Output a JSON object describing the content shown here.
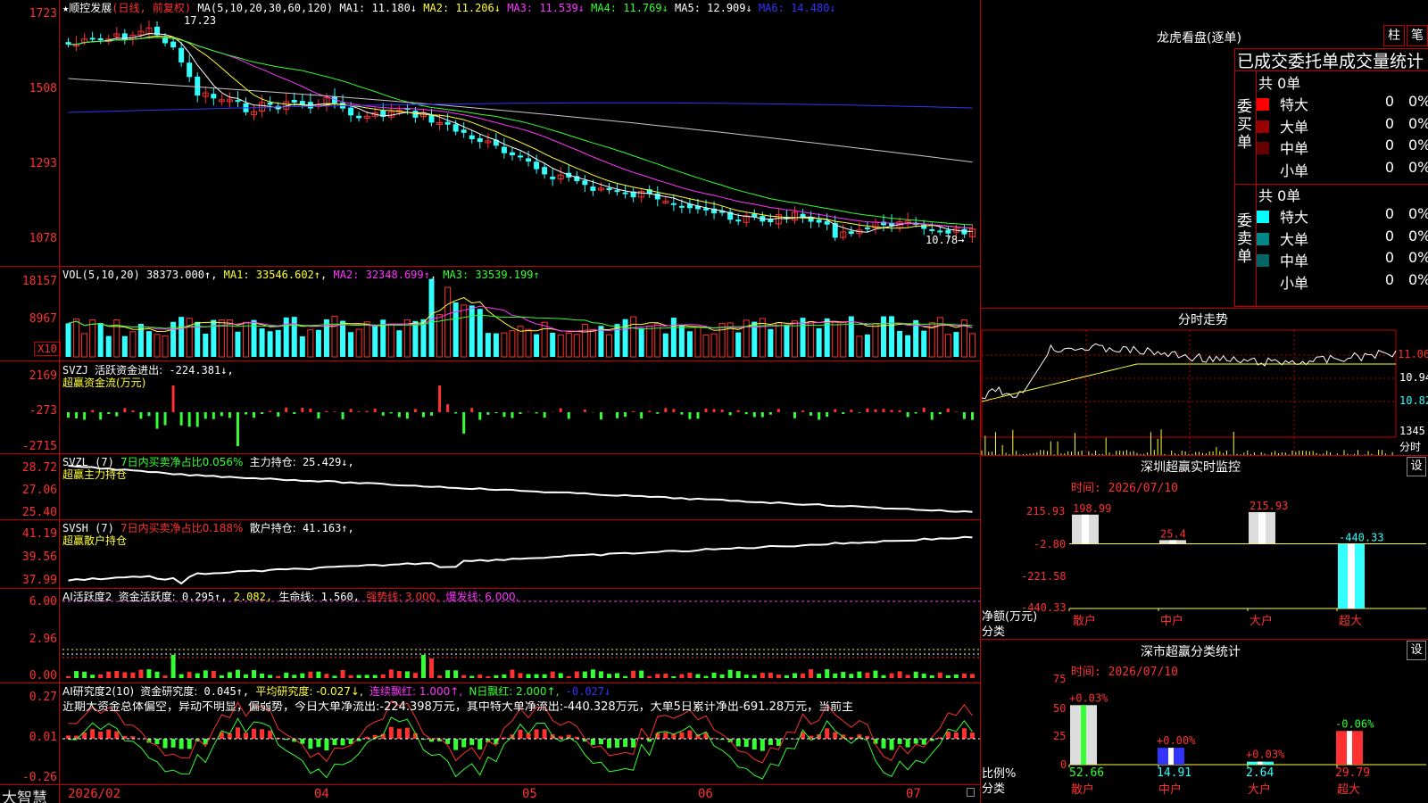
{
  "stock": {
    "name": "顺控发展",
    "period": "(日线, 前复权)",
    "ma_header": "MA(5,10,20,30,60,120)",
    "ma_values": [
      {
        "label": "MA1:",
        "value": "11.180↓",
        "color": "#ffffff"
      },
      {
        "label": "MA2:",
        "value": "11.206↓",
        "color": "#ffff33"
      },
      {
        "label": "MA3:",
        "value": "11.539↓",
        "color": "#ff33ff"
      },
      {
        "label": "MA4:",
        "value": "11.769↓",
        "color": "#33ff33"
      },
      {
        "label": "MA5:",
        "value": "12.909↓",
        "color": "#ffffff"
      },
      {
        "label": "MA6:",
        "value": "14.480↓",
        "color": "#3333ff"
      }
    ],
    "high_label": "17.23",
    "low_label": "10.78→",
    "y_ticks": [
      "1723",
      "1508",
      "1293",
      "1078"
    ]
  },
  "vol": {
    "header": "VOL(5,10,20)",
    "value": "38373.000↑",
    "ma1": "MA1: 33546.602↑",
    "ma2": "MA2: 32348.699↑",
    "ma3": "MA3: 33539.199↑",
    "y_ticks": [
      "18157",
      "8967"
    ],
    "unit_tag": "X10"
  },
  "svzj": {
    "header": "SVZJ",
    "title": "活跃资金进出:",
    "value": "-224.381↓,",
    "subtitle": "超赢资金流(万元)",
    "y_ticks": [
      "2169",
      "-273",
      "-2715"
    ]
  },
  "svzl": {
    "header": "SVZL (7)",
    "ratio": "7日内买卖净占比0.056%",
    "title": "主力持仓:",
    "value": "25.429↓,",
    "subtitle": "超赢主力持仓",
    "y_ticks": [
      "28.72",
      "27.06",
      "25.40"
    ]
  },
  "svsh": {
    "header": "SVSH (7)",
    "ratio": "7日内买卖净占比0.188%",
    "title": "散户持仓:",
    "value": "41.163↑,",
    "subtitle": "超赢散户持仓",
    "y_ticks": [
      "41.19",
      "39.56",
      "37.99"
    ]
  },
  "ai_act": {
    "header": "AI活跃度2",
    "label1": "资金活跃度:",
    "v1": "0.295↑,",
    "v2": "2.082,",
    "label3": "生命线:",
    "v3": "1.560,",
    "v4": "强势线: 3.000,",
    "v5": "爆发线: 6.000,",
    "y_ticks": [
      "6.00",
      "2.96",
      "0.00"
    ]
  },
  "ai_res": {
    "header": "AI研究度2(10)",
    "label1": "资金研究度:",
    "v1": "0.045↑,",
    "v2": "平均研究度: -0.027↓,",
    "v3": "连续飘红: 1.000↑,",
    "v4": "N日飘红: 2.000↑,",
    "v5": "-0.027↓",
    "y_ticks": [
      "0.27",
      "0.01",
      "-0.26"
    ],
    "comment": "近期大资金总体偏空，异动不明显，偏弱势，今日大单净流出:-224.398万元，其中特大单净流出:-440.328万元，大单5日累计净出-691.28万元，当前主"
  },
  "x_axis": {
    "labels": [
      "2026/02",
      "04",
      "05",
      "06",
      "07"
    ]
  },
  "brand": "大智慧",
  "dragon": {
    "title": "龙虎看盘(逐单)",
    "btn1": "柱",
    "btn2": "笔",
    "header": "已成交委托单成交量统计",
    "buy": {
      "side": "委买单",
      "total": "共 0单",
      "rows": [
        {
          "name": "特大",
          "count": "0",
          "pct": "0%",
          "color": "#ff0000"
        },
        {
          "name": "大单",
          "count": "0",
          "pct": "0%",
          "color": "#990000"
        },
        {
          "name": "中单",
          "count": "0",
          "pct": "0%",
          "color": "#660000"
        },
        {
          "name": "小单",
          "count": "0",
          "pct": "0%",
          "color": "#000000"
        }
      ]
    },
    "sell": {
      "side": "委卖单",
      "total": "共 0单",
      "rows": [
        {
          "name": "特大",
          "count": "0",
          "pct": "0%",
          "color": "#00ffff"
        },
        {
          "name": "大单",
          "count": "0",
          "pct": "0%",
          "color": "#008888"
        },
        {
          "name": "中单",
          "count": "0",
          "pct": "0%",
          "color": "#006666"
        },
        {
          "name": "小单",
          "count": "0",
          "pct": "0%",
          "color": "#000000"
        }
      ]
    }
  },
  "intraday": {
    "title": "分时走势",
    "prices": [
      "11.06",
      "10.94",
      "10.82"
    ],
    "vol_label": "1345",
    "vol_unit": "分时"
  },
  "monitor": {
    "title": "深圳超赢实时监控",
    "btn": "设",
    "time": "时间: 2026/07/10",
    "unit_top": "净额(万元)",
    "unit_bot": "分类",
    "y_ticks": [
      "215.93",
      "-2.80",
      "-221.58",
      "-440.33"
    ],
    "chart_data": {
      "type": "bar",
      "categories": [
        "散户",
        "中户",
        "大户",
        "超大"
      ],
      "values": [
        198.99,
        25.4,
        215.93,
        -440.33
      ],
      "labels": [
        "198.99",
        "25.4",
        "215.93",
        "-440.33"
      ],
      "ylim": [
        -440.33,
        215.93
      ]
    }
  },
  "classify": {
    "title": "深市超赢分类统计",
    "btn": "设",
    "time": "时间: 2026/07/10",
    "unit_top": "比例%",
    "unit_bot": "分类",
    "y_ticks": [
      "75",
      "50",
      "25",
      "0"
    ],
    "chart_data": {
      "type": "bar",
      "categories": [
        "散户",
        "中户",
        "大户",
        "超大"
      ],
      "values": [
        52.66,
        14.91,
        2.64,
        29.79
      ],
      "changes": [
        "+0.03%",
        "+0.00%",
        "+0.03%",
        "-0.06%"
      ],
      "ylim": [
        0,
        75
      ]
    }
  }
}
